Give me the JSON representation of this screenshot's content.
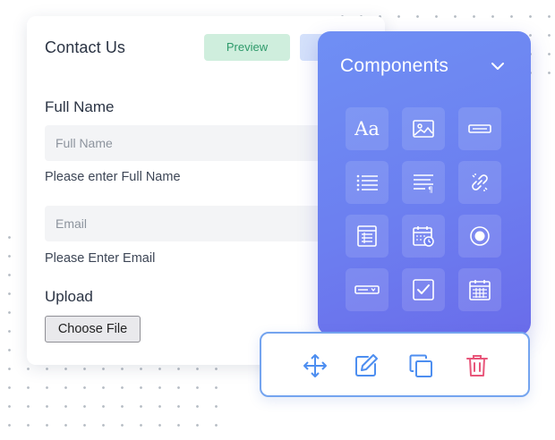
{
  "form": {
    "title": "Contact Us",
    "preview_label": "Preview",
    "fields": [
      {
        "label": "Full Name",
        "placeholder": "Full Name",
        "help": "Please enter Full Name"
      },
      {
        "label": "",
        "placeholder": "Email",
        "help": "Please Enter Email"
      }
    ],
    "upload": {
      "label": "Upload",
      "button_label": "Choose File"
    }
  },
  "components": {
    "title": "Components",
    "toggle_icon": "chevron-down-icon",
    "tiles": [
      {
        "icon": "text-aa-icon",
        "glyph": "Aa"
      },
      {
        "icon": "image-icon"
      },
      {
        "icon": "text-input-icon"
      },
      {
        "icon": "list-icon"
      },
      {
        "icon": "paragraph-icon"
      },
      {
        "icon": "link-icon"
      },
      {
        "icon": "table-icon"
      },
      {
        "icon": "calendar-clock-icon"
      },
      {
        "icon": "radio-icon"
      },
      {
        "icon": "dropdown-icon"
      },
      {
        "icon": "checkbox-icon"
      },
      {
        "icon": "calendar-icon"
      }
    ]
  },
  "toolbar": {
    "tools": [
      "move-icon",
      "edit-icon",
      "duplicate-icon",
      "delete-icon"
    ]
  },
  "colors": {
    "panel_gradient_start": "#6f8ff4",
    "panel_gradient_end": "#6a6cea",
    "preview_bg": "#cfeedd",
    "preview_text": "#2e9a6a",
    "toolbar_border": "#74a4ef",
    "tool_blue": "#4d8ef0",
    "tool_red": "#e8567a"
  }
}
